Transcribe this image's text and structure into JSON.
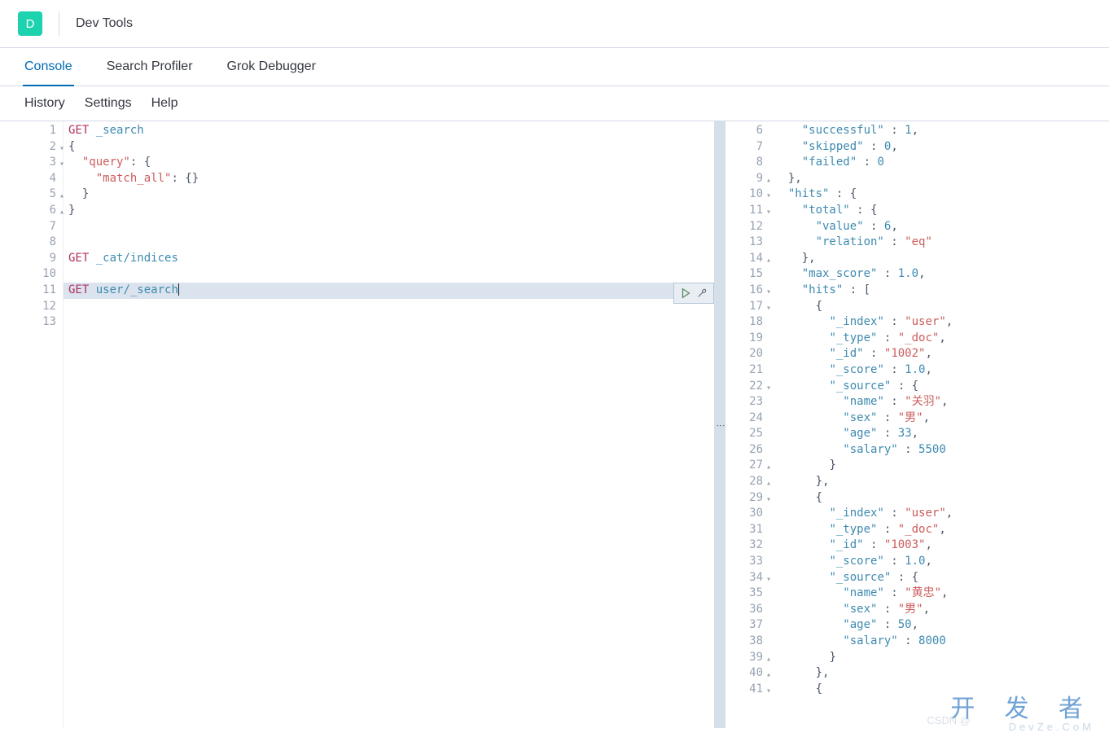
{
  "header": {
    "logo_letter": "D",
    "title": "Dev Tools"
  },
  "tabs": [
    {
      "label": "Console",
      "active": true
    },
    {
      "label": "Search Profiler",
      "active": false
    },
    {
      "label": "Grok Debugger",
      "active": false
    }
  ],
  "subnav": [
    {
      "label": "History"
    },
    {
      "label": "Settings"
    },
    {
      "label": "Help"
    }
  ],
  "request_editor": {
    "lines": [
      {
        "n": 1,
        "tokens": [
          [
            "kw",
            "GET"
          ],
          [
            "sp",
            " "
          ],
          [
            "path",
            "_search"
          ]
        ]
      },
      {
        "n": 2,
        "fold": "open",
        "tokens": [
          [
            "pu",
            "{"
          ]
        ]
      },
      {
        "n": 3,
        "fold": "open",
        "tokens": [
          [
            "sp",
            "  "
          ],
          [
            "str",
            "\"query\""
          ],
          [
            "pu",
            ": {"
          ]
        ]
      },
      {
        "n": 4,
        "tokens": [
          [
            "sp",
            "    "
          ],
          [
            "str",
            "\"match_all\""
          ],
          [
            "pu",
            ": {}"
          ]
        ]
      },
      {
        "n": 5,
        "fold": "close",
        "tokens": [
          [
            "sp",
            "  "
          ],
          [
            "pu",
            "}"
          ]
        ]
      },
      {
        "n": 6,
        "fold": "close",
        "tokens": [
          [
            "pu",
            "}"
          ]
        ]
      },
      {
        "n": 7,
        "tokens": []
      },
      {
        "n": 8,
        "tokens": []
      },
      {
        "n": 9,
        "tokens": [
          [
            "kw",
            "GET"
          ],
          [
            "sp",
            " "
          ],
          [
            "path",
            "_cat/indices"
          ]
        ]
      },
      {
        "n": 10,
        "tokens": []
      },
      {
        "n": 11,
        "highlight": true,
        "cursor": true,
        "tokens": [
          [
            "kw",
            "GET"
          ],
          [
            "sp",
            " "
          ],
          [
            "path",
            "user/_search"
          ]
        ]
      },
      {
        "n": 12,
        "tokens": []
      },
      {
        "n": 13,
        "tokens": []
      }
    ]
  },
  "actions": {
    "run_title": "Run request",
    "wrench_title": "Options"
  },
  "response_editor": {
    "lines": [
      {
        "n": 6,
        "ind": 2,
        "tokens": [
          [
            "key",
            "\"successful\""
          ],
          [
            "pu",
            " : "
          ],
          [
            "num",
            "1"
          ],
          [
            "pu",
            ","
          ]
        ]
      },
      {
        "n": 7,
        "ind": 2,
        "tokens": [
          [
            "key",
            "\"skipped\""
          ],
          [
            "pu",
            " : "
          ],
          [
            "num",
            "0"
          ],
          [
            "pu",
            ","
          ]
        ]
      },
      {
        "n": 8,
        "ind": 2,
        "tokens": [
          [
            "key",
            "\"failed\""
          ],
          [
            "pu",
            " : "
          ],
          [
            "num",
            "0"
          ]
        ]
      },
      {
        "n": 9,
        "fold": "close",
        "ind": 1,
        "tokens": [
          [
            "pu",
            "},"
          ]
        ]
      },
      {
        "n": 10,
        "fold": "open",
        "ind": 1,
        "tokens": [
          [
            "key",
            "\"hits\""
          ],
          [
            "pu",
            " : {"
          ]
        ]
      },
      {
        "n": 11,
        "fold": "open",
        "ind": 2,
        "tokens": [
          [
            "key",
            "\"total\""
          ],
          [
            "pu",
            " : {"
          ]
        ]
      },
      {
        "n": 12,
        "ind": 3,
        "tokens": [
          [
            "key",
            "\"value\""
          ],
          [
            "pu",
            " : "
          ],
          [
            "num",
            "6"
          ],
          [
            "pu",
            ","
          ]
        ]
      },
      {
        "n": 13,
        "ind": 3,
        "tokens": [
          [
            "key",
            "\"relation\""
          ],
          [
            "pu",
            " : "
          ],
          [
            "str",
            "\"eq\""
          ]
        ]
      },
      {
        "n": 14,
        "fold": "close",
        "ind": 2,
        "tokens": [
          [
            "pu",
            "},"
          ]
        ]
      },
      {
        "n": 15,
        "ind": 2,
        "tokens": [
          [
            "key",
            "\"max_score\""
          ],
          [
            "pu",
            " : "
          ],
          [
            "num",
            "1.0"
          ],
          [
            "pu",
            ","
          ]
        ]
      },
      {
        "n": 16,
        "fold": "open",
        "ind": 2,
        "tokens": [
          [
            "key",
            "\"hits\""
          ],
          [
            "pu",
            " : ["
          ]
        ]
      },
      {
        "n": 17,
        "fold": "open",
        "ind": 3,
        "tokens": [
          [
            "pu",
            "{"
          ]
        ]
      },
      {
        "n": 18,
        "ind": 4,
        "tokens": [
          [
            "key",
            "\"_index\""
          ],
          [
            "pu",
            " : "
          ],
          [
            "str",
            "\"user\""
          ],
          [
            "pu",
            ","
          ]
        ]
      },
      {
        "n": 19,
        "ind": 4,
        "tokens": [
          [
            "key",
            "\"_type\""
          ],
          [
            "pu",
            " : "
          ],
          [
            "str",
            "\"_doc\""
          ],
          [
            "pu",
            ","
          ]
        ]
      },
      {
        "n": 20,
        "ind": 4,
        "tokens": [
          [
            "key",
            "\"_id\""
          ],
          [
            "pu",
            " : "
          ],
          [
            "str",
            "\"1002\""
          ],
          [
            "pu",
            ","
          ]
        ]
      },
      {
        "n": 21,
        "ind": 4,
        "tokens": [
          [
            "key",
            "\"_score\""
          ],
          [
            "pu",
            " : "
          ],
          [
            "num",
            "1.0"
          ],
          [
            "pu",
            ","
          ]
        ]
      },
      {
        "n": 22,
        "fold": "open",
        "ind": 4,
        "tokens": [
          [
            "key",
            "\"_source\""
          ],
          [
            "pu",
            " : {"
          ]
        ]
      },
      {
        "n": 23,
        "ind": 5,
        "tokens": [
          [
            "key",
            "\"name\""
          ],
          [
            "pu",
            " : "
          ],
          [
            "str",
            "\"关羽\""
          ],
          [
            "pu",
            ","
          ]
        ]
      },
      {
        "n": 24,
        "ind": 5,
        "tokens": [
          [
            "key",
            "\"sex\""
          ],
          [
            "pu",
            " : "
          ],
          [
            "str",
            "\"男\""
          ],
          [
            "pu",
            ","
          ]
        ]
      },
      {
        "n": 25,
        "ind": 5,
        "tokens": [
          [
            "key",
            "\"age\""
          ],
          [
            "pu",
            " : "
          ],
          [
            "num",
            "33"
          ],
          [
            "pu",
            ","
          ]
        ]
      },
      {
        "n": 26,
        "ind": 5,
        "tokens": [
          [
            "key",
            "\"salary\""
          ],
          [
            "pu",
            " : "
          ],
          [
            "num",
            "5500"
          ]
        ]
      },
      {
        "n": 27,
        "fold": "close",
        "ind": 4,
        "tokens": [
          [
            "pu",
            "}"
          ]
        ]
      },
      {
        "n": 28,
        "fold": "close",
        "ind": 3,
        "tokens": [
          [
            "pu",
            "},"
          ]
        ]
      },
      {
        "n": 29,
        "fold": "open",
        "ind": 3,
        "tokens": [
          [
            "pu",
            "{"
          ]
        ]
      },
      {
        "n": 30,
        "ind": 4,
        "tokens": [
          [
            "key",
            "\"_index\""
          ],
          [
            "pu",
            " : "
          ],
          [
            "str",
            "\"user\""
          ],
          [
            "pu",
            ","
          ]
        ]
      },
      {
        "n": 31,
        "ind": 4,
        "tokens": [
          [
            "key",
            "\"_type\""
          ],
          [
            "pu",
            " : "
          ],
          [
            "str",
            "\"_doc\""
          ],
          [
            "pu",
            ","
          ]
        ]
      },
      {
        "n": 32,
        "ind": 4,
        "tokens": [
          [
            "key",
            "\"_id\""
          ],
          [
            "pu",
            " : "
          ],
          [
            "str",
            "\"1003\""
          ],
          [
            "pu",
            ","
          ]
        ]
      },
      {
        "n": 33,
        "ind": 4,
        "tokens": [
          [
            "key",
            "\"_score\""
          ],
          [
            "pu",
            " : "
          ],
          [
            "num",
            "1.0"
          ],
          [
            "pu",
            ","
          ]
        ]
      },
      {
        "n": 34,
        "fold": "open",
        "ind": 4,
        "tokens": [
          [
            "key",
            "\"_source\""
          ],
          [
            "pu",
            " : {"
          ]
        ]
      },
      {
        "n": 35,
        "ind": 5,
        "tokens": [
          [
            "key",
            "\"name\""
          ],
          [
            "pu",
            " : "
          ],
          [
            "str",
            "\"黄忠\""
          ],
          [
            "pu",
            ","
          ]
        ]
      },
      {
        "n": 36,
        "ind": 5,
        "tokens": [
          [
            "key",
            "\"sex\""
          ],
          [
            "pu",
            " : "
          ],
          [
            "str",
            "\"男\""
          ],
          [
            "pu",
            ","
          ]
        ]
      },
      {
        "n": 37,
        "ind": 5,
        "tokens": [
          [
            "key",
            "\"age\""
          ],
          [
            "pu",
            " : "
          ],
          [
            "num",
            "50"
          ],
          [
            "pu",
            ","
          ]
        ]
      },
      {
        "n": 38,
        "ind": 5,
        "tokens": [
          [
            "key",
            "\"salary\""
          ],
          [
            "pu",
            " : "
          ],
          [
            "num",
            "8000"
          ]
        ]
      },
      {
        "n": 39,
        "fold": "close",
        "ind": 4,
        "tokens": [
          [
            "pu",
            "}"
          ]
        ]
      },
      {
        "n": 40,
        "fold": "close",
        "ind": 3,
        "tokens": [
          [
            "pu",
            "},"
          ]
        ]
      },
      {
        "n": 41,
        "fold": "open",
        "ind": 3,
        "tokens": [
          [
            "pu",
            "{"
          ]
        ]
      }
    ]
  },
  "watermark": {
    "csdn": "CSDN @",
    "main": "开 发 者",
    "sub": "DevZe.CoM"
  }
}
